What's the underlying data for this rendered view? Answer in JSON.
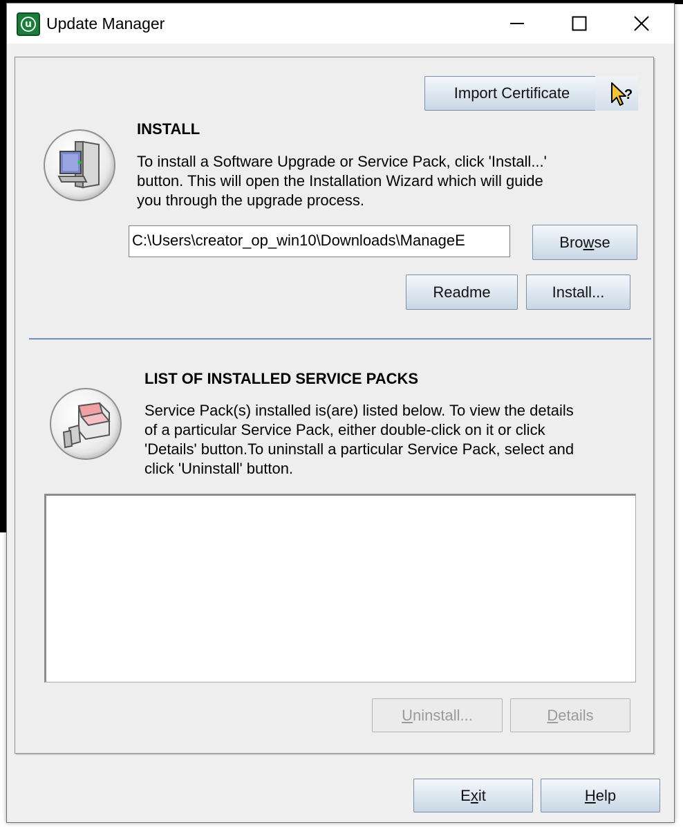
{
  "window": {
    "title": "Update Manager",
    "app_icon_glyph": "u",
    "controls": [
      "minimize-icon",
      "maximize-icon",
      "close-icon"
    ]
  },
  "toolbar": {
    "import_certificate_label": "Import Certificate",
    "help_cursor_icon": "context-help-cursor-icon"
  },
  "install": {
    "heading": "INSTALL",
    "description_lines": [
      "To install a Software Upgrade or Service Pack, click 'Install...'",
      "button. This will open the Installation Wizard which will guide",
      "you through the upgrade process."
    ],
    "icon": "computer-icon",
    "path_value": "C:\\Users\\creator_op_win10\\Downloads\\ManageE",
    "browse_label_pre": "Bro",
    "browse_label_mnemonic": "w",
    "browse_label_post": "se",
    "readme_label": "Readme",
    "install_label": "Install..."
  },
  "service_packs": {
    "heading": "LIST OF INSTALLED SERVICE PACKS",
    "description_lines": [
      "Service Pack(s) installed is(are) listed below. To view the details",
      "of a particular Service Pack, either double-click on it or click",
      "'Details' button.To uninstall a particular Service Pack, select and",
      "click 'Uninstall' button."
    ],
    "icon": "service-pack-icon",
    "items": [],
    "uninstall_mnemonic": "U",
    "uninstall_rest": "ninstall...",
    "details_mnemonic": "D",
    "details_rest": "etails"
  },
  "footer": {
    "exit_pre": "E",
    "exit_mnemonic": "x",
    "exit_post": "it",
    "help_mnemonic": "H",
    "help_rest": "elp"
  },
  "colors": {
    "app_icon": "#1f7a3e",
    "separator": "#6f8cbc",
    "button_border": "#7a8ea8"
  }
}
